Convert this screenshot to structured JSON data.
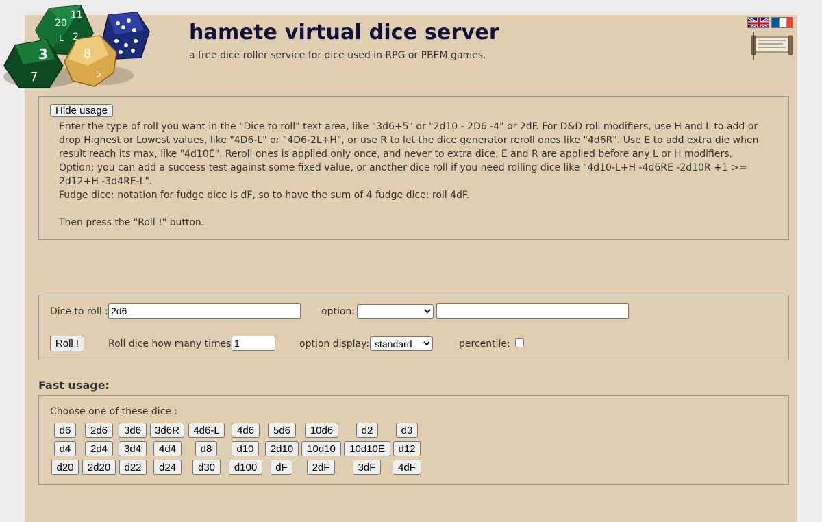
{
  "header": {
    "title": "hamete virtual dice server",
    "subtitle": "a free dice roller service for dice used in RPG or PBEM games."
  },
  "usage": {
    "hide_button": "Hide usage",
    "paragraphs": [
      "Enter the type of roll you want in the \"Dice to roll\" text area, like \"3d6+5\" or \"2d10 - 2D6 -4\" or 2dF. For D&D roll modifiers, use H and L to add or drop Highest or Lowest values, like \"4D6-L\" or \"4D6-2L+H\", or use R to let the dice generator reroll ones like \"4d6R\". Use E to add extra die when result reach its max, like \"4d10E\". Reroll ones is applied only once, and never to extra dice. E and R are applied before any L or H modifiers.",
      "Option: you can add a success test against some fixed value, or another dice roll if you need rolling dice like \"4d10-L+H -4d6RE -2d10R +1 >= 2d12+H -3d4RE-L\".",
      "Fudge dice: notation for fudge dice is dF, so to have the sum of 4 fudge dice: roll 4dF.",
      "Then press the \"Roll !\" button."
    ]
  },
  "roll_form": {
    "dice_label": "Dice to roll :",
    "dice_value": "2d6",
    "option_label": "option:",
    "option_selected": "",
    "option_value": "",
    "roll_button": "Roll !",
    "times_label": "Roll dice how many times:",
    "times_value": "1",
    "display_label": "option display:",
    "display_selected": "standard",
    "percentile_label": "percentile:",
    "percentile_checked": false
  },
  "fast": {
    "title": "Fast usage:",
    "choose_label": "Choose one of these dice :",
    "rows": [
      [
        "d6",
        "2d6",
        "3d6",
        "3d6R",
        "4d6-L",
        "4d6",
        "5d6",
        "10d6",
        "d2",
        "d3"
      ],
      [
        "d4",
        "2d4",
        "3d4",
        "4d4",
        "d8",
        "d10",
        "2d10",
        "10d10",
        "10d10E",
        "d12"
      ],
      [
        "d20",
        "2d20",
        "d22",
        "d24",
        "d30",
        "d100",
        "dF",
        "2dF",
        "3dF",
        "4dF"
      ]
    ]
  },
  "colors": {
    "page_bg": "#dfcfb0",
    "outer_bg": "#edebec",
    "title": "#13103e"
  },
  "icons": [
    "dice-logo",
    "uk-flag-icon",
    "french-flag-icon",
    "scroll-icon"
  ]
}
